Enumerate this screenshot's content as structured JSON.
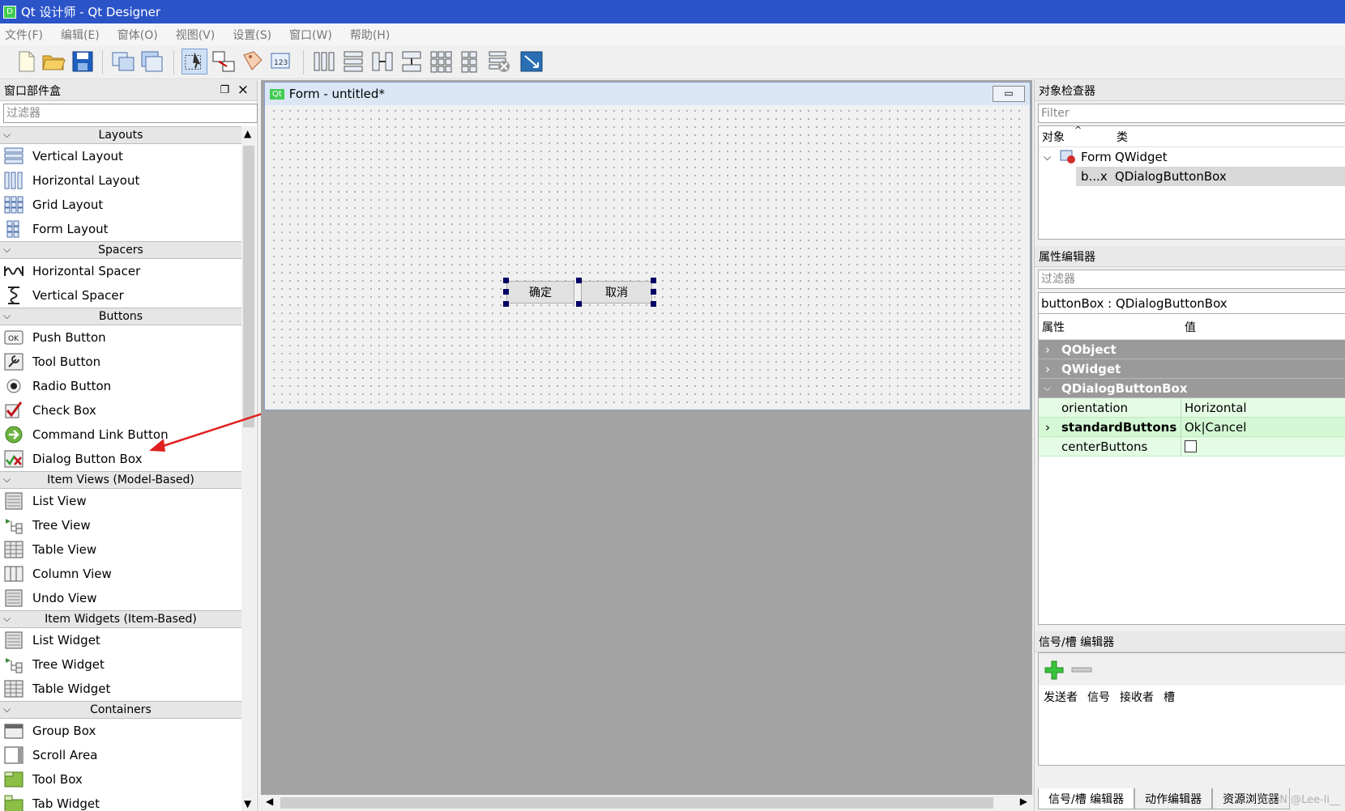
{
  "window": {
    "title": "Qt 设计师 - Qt Designer",
    "app_icon": "D"
  },
  "menubar": [
    "文件(F)",
    "编辑(E)",
    "窗体(O)",
    "视图(V)",
    "设置(S)",
    "窗口(W)",
    "帮助(H)"
  ],
  "widget_box": {
    "title": "窗口部件盒",
    "filter_placeholder": "过滤器",
    "sections": [
      {
        "name": "Layouts",
        "items": [
          {
            "label": "Vertical Layout",
            "icon": "vertical-layout-icon"
          },
          {
            "label": "Horizontal Layout",
            "icon": "horizontal-layout-icon"
          },
          {
            "label": "Grid Layout",
            "icon": "grid-layout-icon"
          },
          {
            "label": "Form Layout",
            "icon": "form-layout-icon"
          }
        ]
      },
      {
        "name": "Spacers",
        "items": [
          {
            "label": "Horizontal Spacer",
            "icon": "horizontal-spacer-icon"
          },
          {
            "label": "Vertical Spacer",
            "icon": "vertical-spacer-icon"
          }
        ]
      },
      {
        "name": "Buttons",
        "items": [
          {
            "label": "Push Button",
            "icon": "push-button-icon"
          },
          {
            "label": "Tool Button",
            "icon": "tool-button-icon"
          },
          {
            "label": "Radio Button",
            "icon": "radio-button-icon"
          },
          {
            "label": "Check Box",
            "icon": "check-box-icon"
          },
          {
            "label": "Command Link Button",
            "icon": "command-link-icon"
          },
          {
            "label": "Dialog Button Box",
            "icon": "dialog-button-box-icon"
          }
        ]
      },
      {
        "name": "Item Views (Model-Based)",
        "items": [
          {
            "label": "List View",
            "icon": "list-view-icon"
          },
          {
            "label": "Tree View",
            "icon": "tree-view-icon"
          },
          {
            "label": "Table View",
            "icon": "table-view-icon"
          },
          {
            "label": "Column View",
            "icon": "column-view-icon"
          },
          {
            "label": "Undo View",
            "icon": "undo-view-icon"
          }
        ]
      },
      {
        "name": "Item Widgets (Item-Based)",
        "items": [
          {
            "label": "List Widget",
            "icon": "list-widget-icon"
          },
          {
            "label": "Tree Widget",
            "icon": "tree-widget-icon"
          },
          {
            "label": "Table Widget",
            "icon": "table-widget-icon"
          }
        ]
      },
      {
        "name": "Containers",
        "items": [
          {
            "label": "Group Box",
            "icon": "group-box-icon"
          },
          {
            "label": "Scroll Area",
            "icon": "scroll-area-icon"
          },
          {
            "label": "Tool Box",
            "icon": "tool-box-icon"
          },
          {
            "label": "Tab Widget",
            "icon": "tab-widget-icon"
          }
        ]
      }
    ]
  },
  "form": {
    "title": "Form - untitled*",
    "qt_badge": "Qt",
    "ok_button": "确定",
    "cancel_button": "取消"
  },
  "object_inspector": {
    "title": "对象检查器",
    "filter_placeholder": "Filter",
    "col_object": "对象",
    "col_class": "类",
    "rows": [
      {
        "object": "Form",
        "class": "QWidget"
      },
      {
        "object": "b...x",
        "class": "QDialogButtonBox"
      }
    ]
  },
  "property_editor": {
    "title": "属性编辑器",
    "filter_placeholder": "过滤器",
    "object_class": "buttonBox : QDialogButtonBox",
    "col_property": "属性",
    "col_value": "值",
    "groups": [
      "QObject",
      "QWidget",
      "QDialogButtonBox"
    ],
    "rows": [
      {
        "name": "orientation",
        "value": "Horizontal"
      },
      {
        "name": "standardButtons",
        "value": "Ok|Cancel"
      },
      {
        "name": "centerButtons",
        "value": ""
      }
    ]
  },
  "signal_slot_editor": {
    "title": "信号/槽 编辑器",
    "cols": [
      "发送者",
      "信号",
      "接收者",
      "槽"
    ]
  },
  "bottom_tabs": [
    "信号/槽 编辑器",
    "动作编辑器",
    "资源浏览器"
  ],
  "watermark": "CSDN @Lee-li__"
}
